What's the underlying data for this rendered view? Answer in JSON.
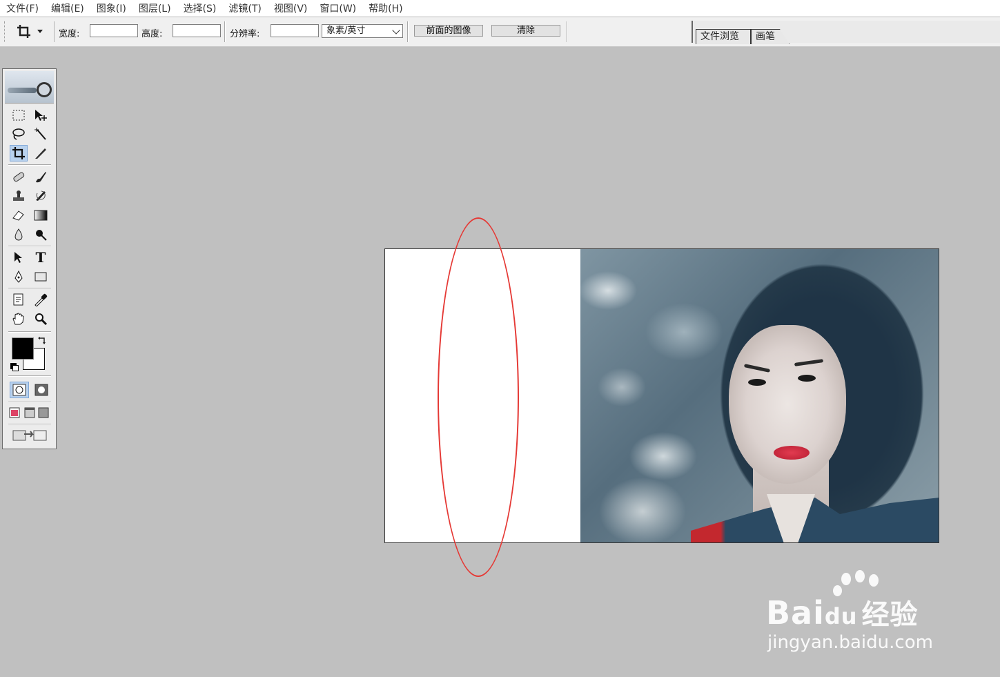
{
  "menu": [
    "文件(F)",
    "编辑(E)",
    "图象(I)",
    "图层(L)",
    "选择(S)",
    "滤镜(T)",
    "视图(V)",
    "窗口(W)",
    "帮助(H)"
  ],
  "options_bar": {
    "width_label": "宽度:",
    "width_value": "",
    "height_label": "高度:",
    "height_value": "",
    "resolution_label": "分辨率:",
    "resolution_value": "",
    "unit_selected": "象素/英寸",
    "front_image_button": "前面的图像",
    "clear_button": "清除"
  },
  "palette_well": {
    "tabs": [
      "文件浏览",
      "画笔"
    ]
  },
  "toolbox": {
    "tools": [
      "rectangular-marquee-icon",
      "move-icon",
      "lasso-icon",
      "magic-wand-icon",
      "crop-icon",
      "slice-icon",
      "healing-brush-icon",
      "brush-icon",
      "clone-stamp-icon",
      "history-brush-icon",
      "eraser-icon",
      "gradient-icon",
      "blur-icon",
      "dodge-icon",
      "path-selection-icon",
      "type-icon",
      "pen-icon",
      "rectangle-shape-icon",
      "notes-icon",
      "eyedropper-icon",
      "hand-icon",
      "zoom-icon"
    ],
    "active_tool": "crop-icon",
    "type_tool_glyph": "T",
    "foreground_color": "#000000",
    "background_color": "#ffffff"
  },
  "annotation_color": "#e53935",
  "watermark": {
    "brand": "Bai",
    "brand_suffix": "du",
    "brand_cn": "经验",
    "url": "jingyan.baidu.com"
  }
}
